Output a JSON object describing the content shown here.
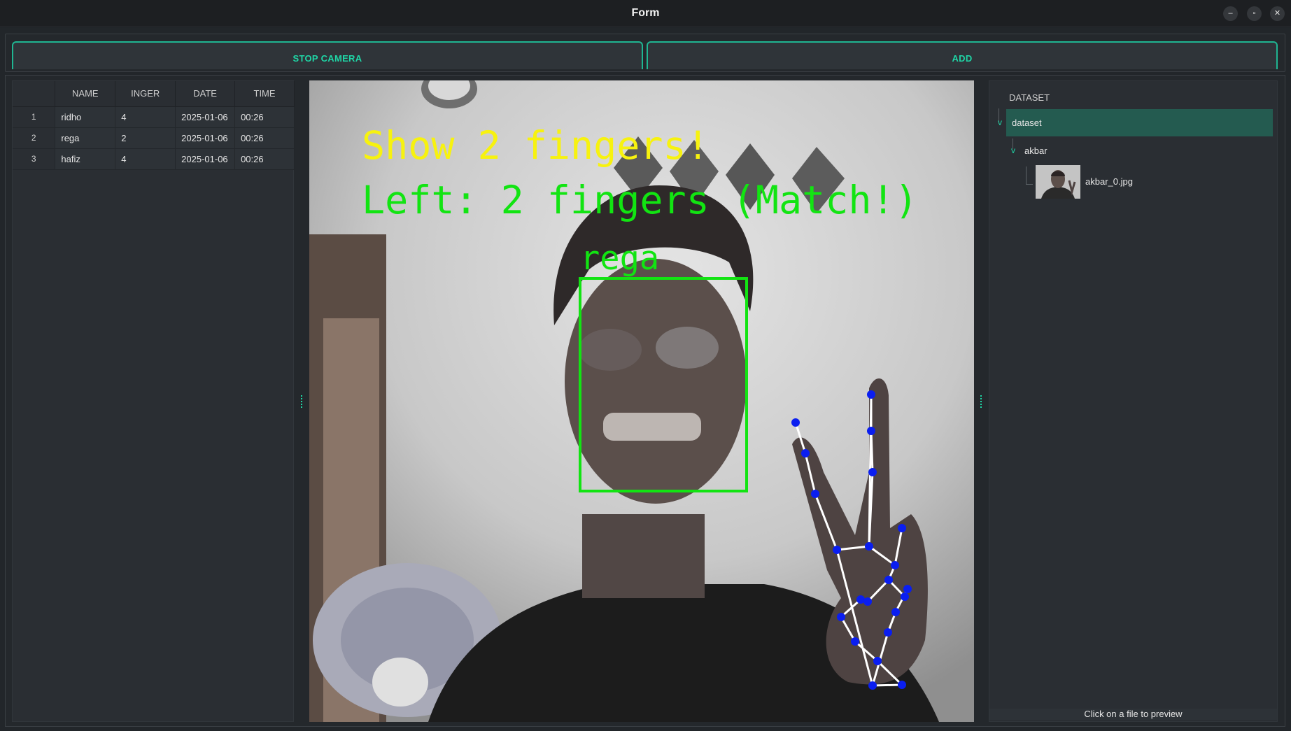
{
  "window": {
    "title": "Form",
    "controls": [
      "minimize",
      "restore",
      "close"
    ]
  },
  "toolbar": {
    "stop_camera_label": "STOP CAMERA",
    "add_label": "ADD"
  },
  "table": {
    "columns": [
      "NAME",
      "INGER",
      "DATE",
      "TIME"
    ],
    "rows": [
      {
        "index": "1",
        "name": "ridho",
        "finger": "4",
        "date": "2025-01-06",
        "time": "00:26"
      },
      {
        "index": "2",
        "name": "rega",
        "finger": "2",
        "date": "2025-01-06",
        "time": "00:26"
      },
      {
        "index": "3",
        "name": "hafiz",
        "finger": "4",
        "date": "2025-01-06",
        "time": "00:26"
      }
    ]
  },
  "camera": {
    "prompt": "Show 2 fingers!",
    "status": "Left: 2 fingers (Match!)",
    "face_label": "rega",
    "colors": {
      "prompt": "#f7f20f",
      "status": "#12e412",
      "landmark": "#0a1ef0"
    }
  },
  "dataset": {
    "header": "DATASET",
    "root": "dataset",
    "folder": "akbar",
    "file": "akbar_0.jpg",
    "preview_hint": "Click on a file to preview"
  },
  "theme": {
    "accent": "#1fd6a6",
    "selection": "#245b50"
  }
}
